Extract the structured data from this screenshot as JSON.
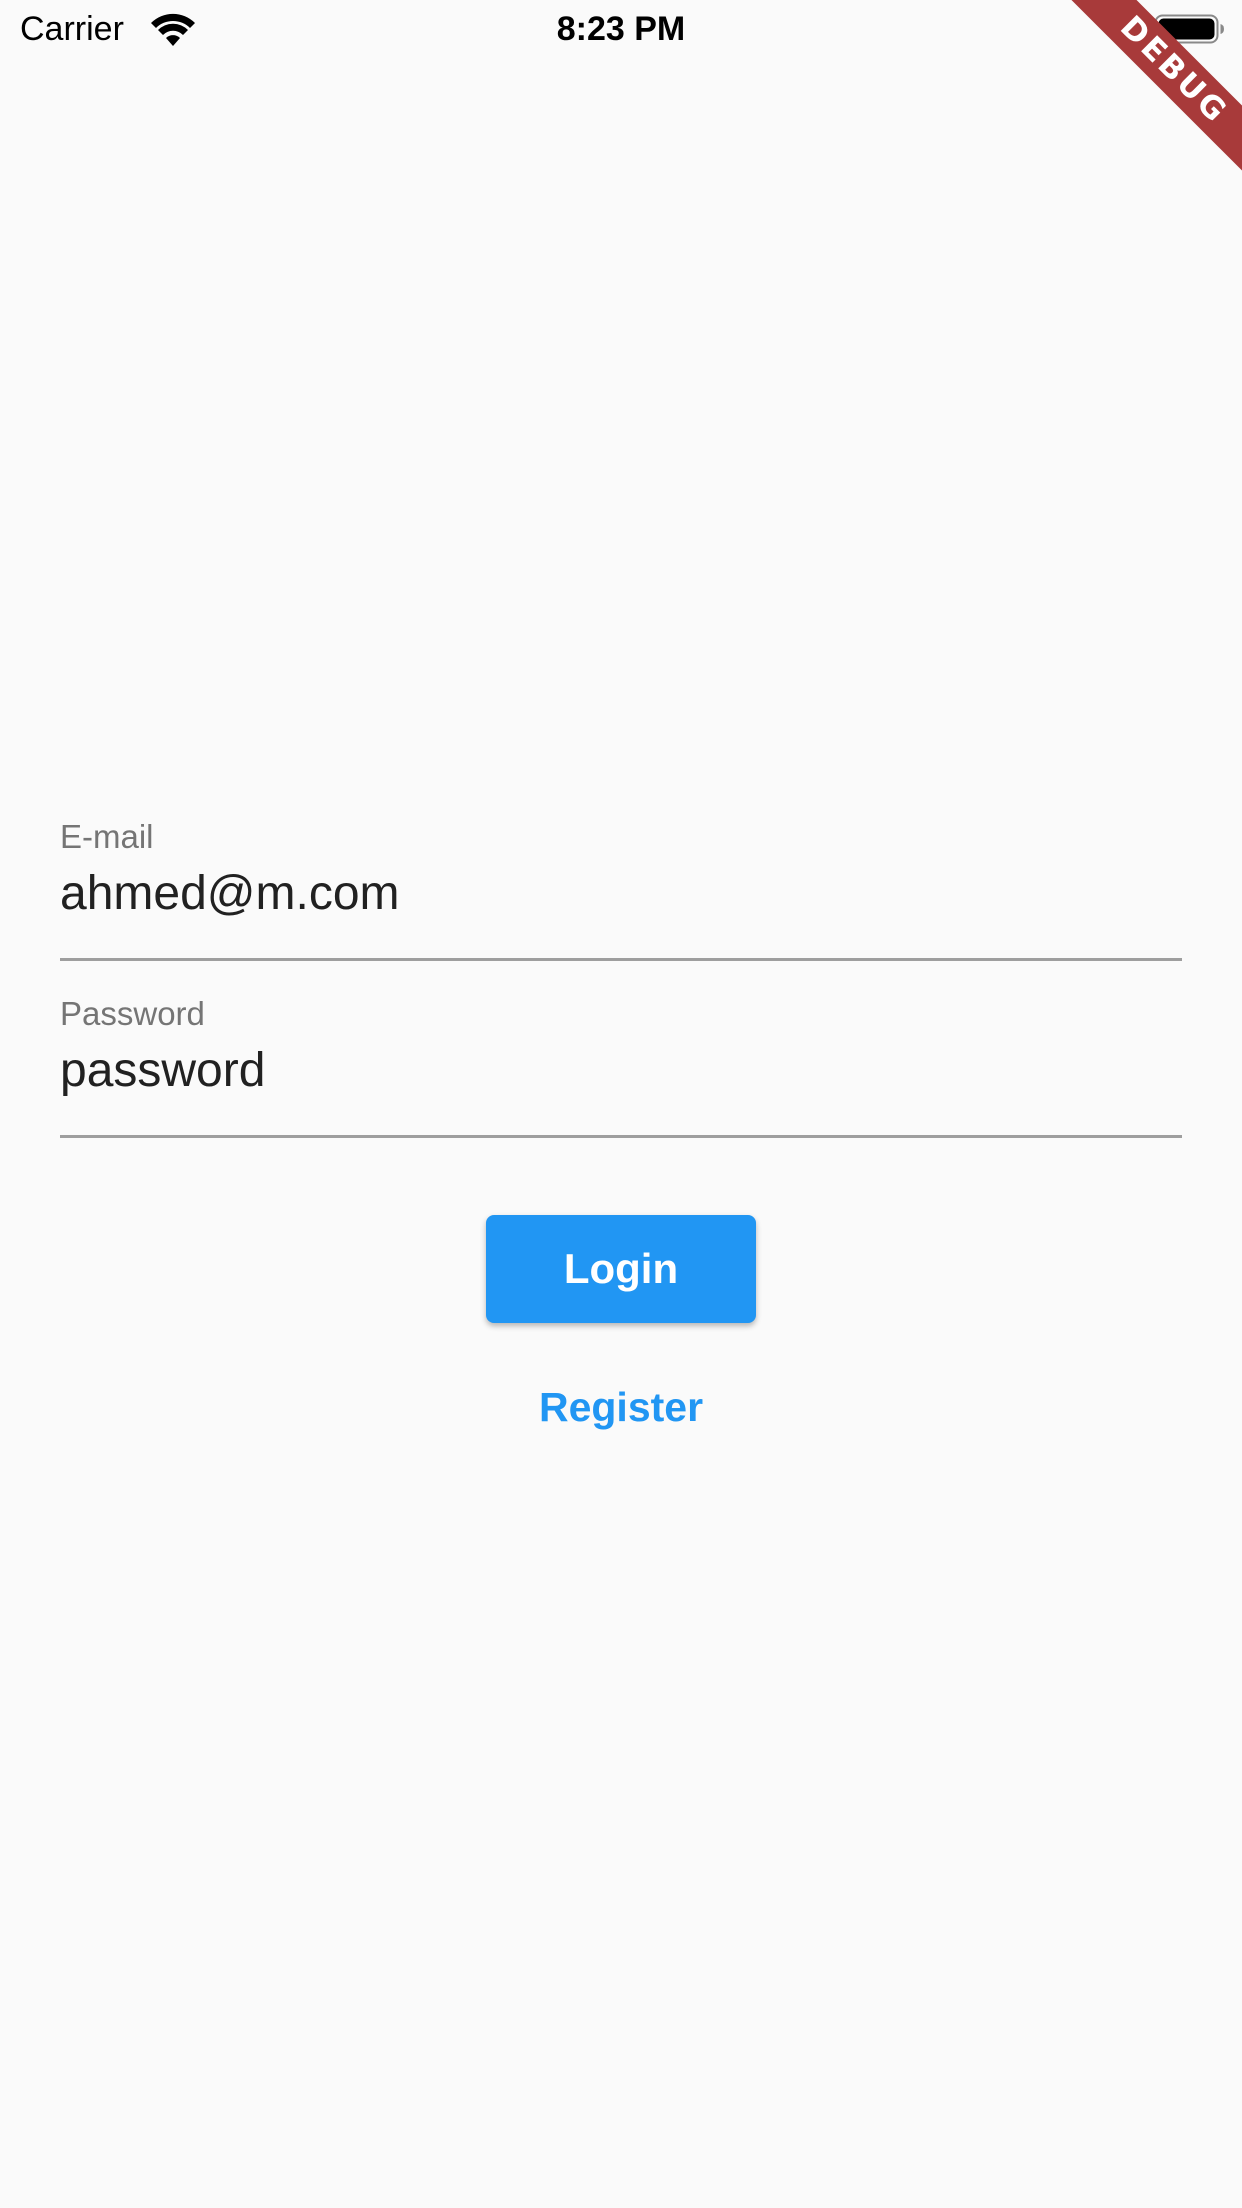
{
  "status_bar": {
    "carrier": "Carrier",
    "time": "8:23 PM",
    "wifi_icon": "wifi-icon",
    "battery_icon": "battery-full-icon"
  },
  "debug_banner": {
    "label": "DEBUG",
    "color": "#a83a3a"
  },
  "form": {
    "email": {
      "label": "E-mail",
      "value": "ahmed@m.com"
    },
    "password": {
      "label": "Password",
      "value": "password"
    },
    "login_label": "Login",
    "register_label": "Register"
  },
  "colors": {
    "accent": "#2196f3",
    "background": "#fafafa",
    "underline": "#9e9e9e",
    "label": "#757575"
  }
}
